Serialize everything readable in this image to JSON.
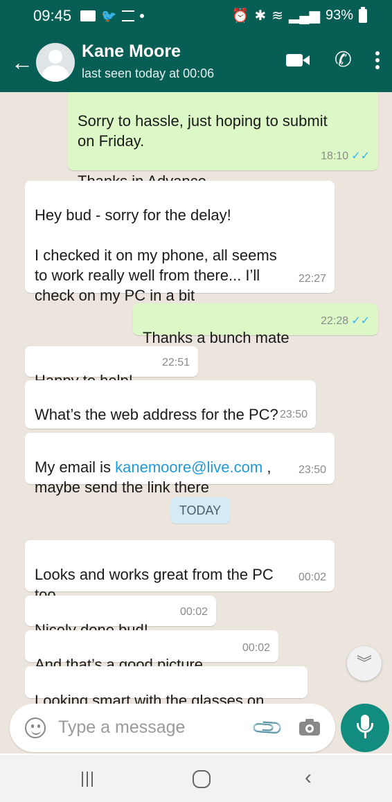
{
  "status_bar": {
    "time": "09:45",
    "battery": "93%"
  },
  "header": {
    "contact_name": "Kane Moore",
    "last_seen": "last seen today at 00:06"
  },
  "messages": [
    {
      "direction": "out",
      "text": "Sorry to hassle, just hoping to submit\non Friday.\n\nThanks in Advance.",
      "time": "18:10",
      "ticks": "✓✓"
    },
    {
      "direction": "in",
      "text": "Hey bud - sorry for the delay!\n\nI checked it on my phone, all seems\nto work really well from there... I’ll\ncheck on my PC in a bit",
      "time": "22:27"
    },
    {
      "direction": "out",
      "text": "Thanks a bunch mate",
      "time": "22:28",
      "ticks": "✓✓"
    },
    {
      "direction": "in",
      "text": "Happy to help!",
      "time": "22:51"
    },
    {
      "direction": "in",
      "text": "What’s the web address for the PC?",
      "time": "23:50"
    },
    {
      "direction": "in",
      "text_before": "My email is ",
      "link": "kanemoore@live.com",
      "text_after": " ,\nmaybe send the link there",
      "time": "23:50"
    },
    {
      "direction": "in",
      "text": "Looks and works great from the PC\ntoo",
      "time": "00:02"
    },
    {
      "direction": "in",
      "text": "Nicely done bud!",
      "time": "00:02"
    },
    {
      "direction": "in",
      "text": "And that’s a good picture",
      "time": "00:02"
    },
    {
      "direction": "in",
      "text": "Looking smart with the glasses on",
      "time": ""
    }
  ],
  "day_separator": "TODAY",
  "input": {
    "placeholder": "Type a message"
  },
  "colors": {
    "header": "#075e54",
    "chat_background": "#ece5dd",
    "outgoing_bubble": "#dcf8c6",
    "incoming_bubble": "#ffffff",
    "mic_button": "#128c7e",
    "read_ticks": "#34b7f1"
  },
  "icons": [
    "back-arrow-icon",
    "avatar-icon",
    "video-call-icon",
    "phone-icon",
    "more-options-icon",
    "emoji-icon",
    "attach-icon",
    "camera-icon",
    "mic-icon",
    "scroll-down-icon",
    "nav-recents-icon",
    "nav-home-icon",
    "nav-back-icon"
  ]
}
